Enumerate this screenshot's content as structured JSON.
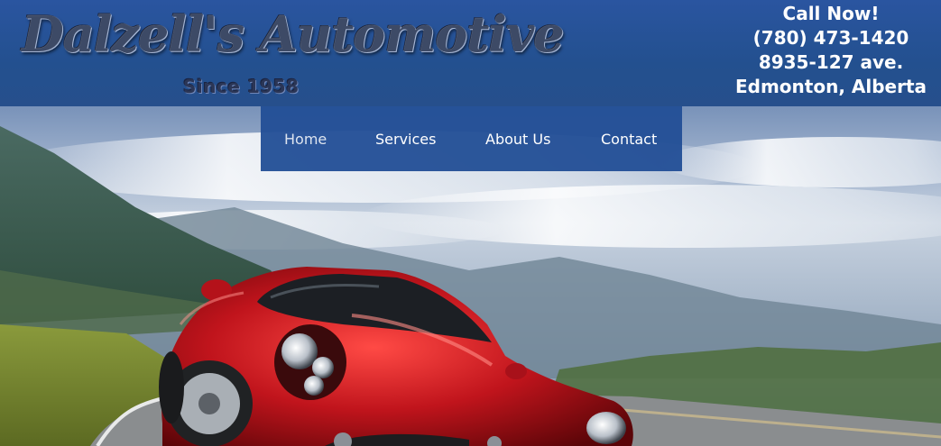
{
  "header": {
    "logo_text": "Dalzell's Automotive",
    "tagline": "Since 1958"
  },
  "contact": {
    "call_label": "Call Now!",
    "phone": "(780) 473-1420",
    "address": "8935-127 ave.",
    "city": "Edmonton, Alberta"
  },
  "nav": {
    "items": [
      {
        "label": "Home",
        "active": true
      },
      {
        "label": "Services",
        "active": false
      },
      {
        "label": "About Us",
        "active": false
      },
      {
        "label": "Contact",
        "active": false
      }
    ]
  },
  "colors": {
    "header_blue": "#23508f",
    "nav_blue": "#224e96",
    "car_red": "#c0141c"
  }
}
